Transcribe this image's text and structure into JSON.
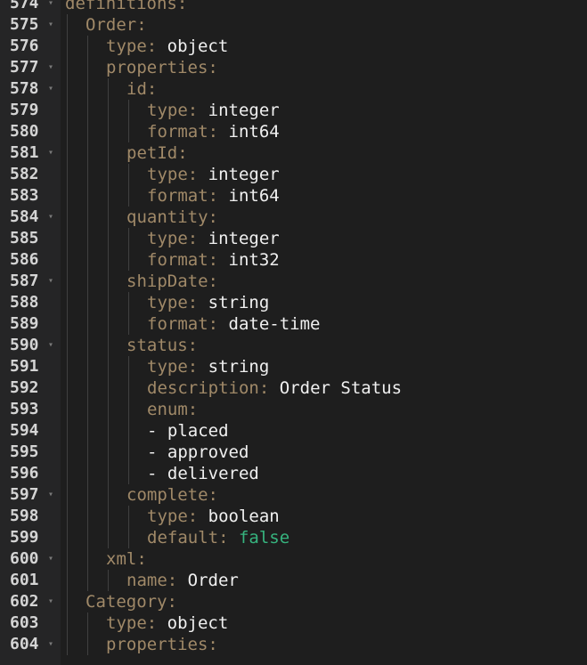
{
  "editor": {
    "lines": [
      {
        "num": "574",
        "indent": 0,
        "fold": true,
        "key": "definitions",
        "colon": ":",
        "value": "",
        "vtype": ""
      },
      {
        "num": "575",
        "indent": 1,
        "fold": true,
        "key": "Order",
        "colon": ":",
        "value": "",
        "vtype": ""
      },
      {
        "num": "576",
        "indent": 2,
        "fold": false,
        "key": "type",
        "colon": ":",
        "value": "object",
        "vtype": "val"
      },
      {
        "num": "577",
        "indent": 2,
        "fold": true,
        "key": "properties",
        "colon": ":",
        "value": "",
        "vtype": ""
      },
      {
        "num": "578",
        "indent": 3,
        "fold": true,
        "key": "id",
        "colon": ":",
        "value": "",
        "vtype": ""
      },
      {
        "num": "579",
        "indent": 4,
        "fold": false,
        "key": "type",
        "colon": ":",
        "value": "integer",
        "vtype": "val"
      },
      {
        "num": "580",
        "indent": 4,
        "fold": false,
        "key": "format",
        "colon": ":",
        "value": "int64",
        "vtype": "val"
      },
      {
        "num": "581",
        "indent": 3,
        "fold": true,
        "key": "petId",
        "colon": ":",
        "value": "",
        "vtype": ""
      },
      {
        "num": "582",
        "indent": 4,
        "fold": false,
        "key": "type",
        "colon": ":",
        "value": "integer",
        "vtype": "val"
      },
      {
        "num": "583",
        "indent": 4,
        "fold": false,
        "key": "format",
        "colon": ":",
        "value": "int64",
        "vtype": "val"
      },
      {
        "num": "584",
        "indent": 3,
        "fold": true,
        "key": "quantity",
        "colon": ":",
        "value": "",
        "vtype": ""
      },
      {
        "num": "585",
        "indent": 4,
        "fold": false,
        "key": "type",
        "colon": ":",
        "value": "integer",
        "vtype": "val"
      },
      {
        "num": "586",
        "indent": 4,
        "fold": false,
        "key": "format",
        "colon": ":",
        "value": "int32",
        "vtype": "val"
      },
      {
        "num": "587",
        "indent": 3,
        "fold": true,
        "key": "shipDate",
        "colon": ":",
        "value": "",
        "vtype": ""
      },
      {
        "num": "588",
        "indent": 4,
        "fold": false,
        "key": "type",
        "colon": ":",
        "value": "string",
        "vtype": "val"
      },
      {
        "num": "589",
        "indent": 4,
        "fold": false,
        "key": "format",
        "colon": ":",
        "value": "date-time",
        "vtype": "val"
      },
      {
        "num": "590",
        "indent": 3,
        "fold": true,
        "key": "status",
        "colon": ":",
        "value": "",
        "vtype": ""
      },
      {
        "num": "591",
        "indent": 4,
        "fold": false,
        "key": "type",
        "colon": ":",
        "value": "string",
        "vtype": "val"
      },
      {
        "num": "592",
        "indent": 4,
        "fold": false,
        "key": "description",
        "colon": ":",
        "value": "Order Status",
        "vtype": "val"
      },
      {
        "num": "593",
        "indent": 4,
        "fold": false,
        "key": "enum",
        "colon": ":",
        "value": "",
        "vtype": ""
      },
      {
        "num": "594",
        "indent": 4,
        "fold": false,
        "key": "",
        "colon": "",
        "value": "- placed",
        "vtype": "val"
      },
      {
        "num": "595",
        "indent": 4,
        "fold": false,
        "key": "",
        "colon": "",
        "value": "- approved",
        "vtype": "val"
      },
      {
        "num": "596",
        "indent": 4,
        "fold": false,
        "key": "",
        "colon": "",
        "value": "- delivered",
        "vtype": "val"
      },
      {
        "num": "597",
        "indent": 3,
        "fold": true,
        "key": "complete",
        "colon": ":",
        "value": "",
        "vtype": ""
      },
      {
        "num": "598",
        "indent": 4,
        "fold": false,
        "key": "type",
        "colon": ":",
        "value": "boolean",
        "vtype": "val"
      },
      {
        "num": "599",
        "indent": 4,
        "fold": false,
        "key": "default",
        "colon": ":",
        "value": "false",
        "vtype": "bool"
      },
      {
        "num": "600",
        "indent": 2,
        "fold": true,
        "key": "xml",
        "colon": ":",
        "value": "",
        "vtype": ""
      },
      {
        "num": "601",
        "indent": 3,
        "fold": false,
        "key": "name",
        "colon": ":",
        "value": "Order",
        "vtype": "val"
      },
      {
        "num": "602",
        "indent": 1,
        "fold": true,
        "key": "Category",
        "colon": ":",
        "value": "",
        "vtype": ""
      },
      {
        "num": "603",
        "indent": 2,
        "fold": false,
        "key": "type",
        "colon": ":",
        "value": "object",
        "vtype": "val"
      },
      {
        "num": "604",
        "indent": 2,
        "fold": true,
        "key": "properties",
        "colon": ":",
        "value": "",
        "vtype": ""
      }
    ],
    "fold_icon": "chevron-down-icon",
    "colors": {
      "background": "#1e1e1e",
      "key": "#a08968",
      "value": "#f0f0f0",
      "boolean": "#36b37e",
      "line_number": "#d4d4d4"
    }
  }
}
